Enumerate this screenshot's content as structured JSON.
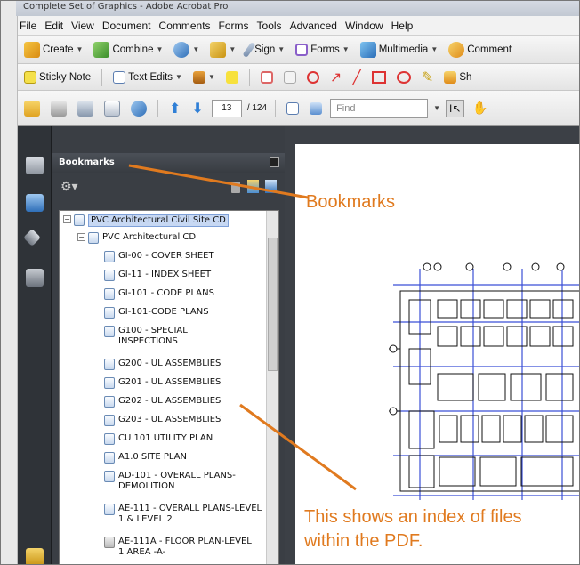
{
  "window": {
    "title": "Complete Set of Graphics - Adobe Acrobat Pro"
  },
  "menu": [
    "File",
    "Edit",
    "View",
    "Document",
    "Comments",
    "Forms",
    "Tools",
    "Advanced",
    "Window",
    "Help"
  ],
  "toolbar1": {
    "create": "Create",
    "combine": "Combine",
    "sign": "Sign",
    "forms": "Forms",
    "multimedia": "Multimedia",
    "comment": "Comment"
  },
  "toolbar2": {
    "sticky_note": "Sticky Note",
    "text_edits": "Text Edits",
    "show": "Sh"
  },
  "toolbar3": {
    "current_page": "13",
    "total_pages": "/ 124",
    "find_placeholder": "Find"
  },
  "bookmarks_panel": {
    "title": "Bookmarks",
    "items": [
      {
        "label": "PVC Architectural Civil Site CD"
      },
      {
        "label": "PVC Architectural CD"
      },
      {
        "label": "GI-00 - COVER SHEET"
      },
      {
        "label": "GI-11 - INDEX SHEET"
      },
      {
        "label": "GI-101 - CODE PLANS"
      },
      {
        "label": "GI-101-CODE PLANS"
      },
      {
        "label": "G100 - SPECIAL INSPECTIONS"
      },
      {
        "label": "G200 - UL ASSEMBLIES"
      },
      {
        "label": "G201 - UL ASSEMBLIES"
      },
      {
        "label": "G202 - UL ASSEMBLIES"
      },
      {
        "label": "G203 - UL ASSEMBLIES"
      },
      {
        "label": "CU 101  UTILITY PLAN"
      },
      {
        "label": "A1.0  SITE PLAN"
      },
      {
        "label": "AD-101 - OVERALL PLANS-DEMOLITION"
      },
      {
        "label": "AE-111 - OVERALL PLANS-LEVEL 1 & LEVEL 2"
      },
      {
        "label": "AE-111A - FLOOR PLAN-LEVEL 1 AREA -A-"
      }
    ]
  },
  "annotations": {
    "bookmarks_label": "Bookmarks",
    "index_note": "This shows an index of files within the PDF."
  },
  "colors": {
    "annotation": "#e07a1f",
    "selection": "#c7d8f3",
    "panel_dark": "#3a3e44",
    "blueprint_line": "#3b4fd6"
  },
  "icons": {
    "create": "create-pdf-icon",
    "combine": "combine-files-icon",
    "sign": "sign-pen-icon",
    "forms": "forms-icon",
    "multimedia": "multimedia-icon",
    "comment": "comment-icon"
  }
}
